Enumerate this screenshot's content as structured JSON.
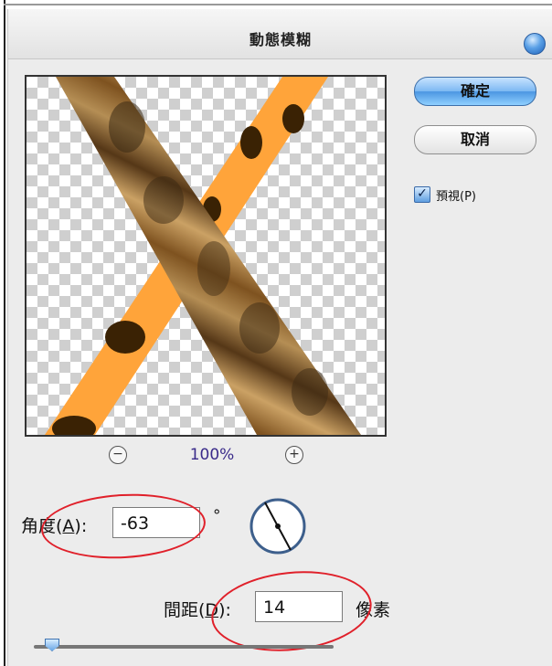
{
  "dialog": {
    "title": "動態模糊"
  },
  "buttons": {
    "ok_label": "確定",
    "cancel_label": "取消"
  },
  "preview_option": {
    "label": "預視(P)",
    "checked": true
  },
  "zoom": {
    "level": "100%",
    "minus": "−",
    "plus": "+"
  },
  "angle": {
    "label_prefix": "角度(",
    "label_key": "A",
    "label_suffix": "):",
    "value": "-63",
    "unit": "°"
  },
  "distance": {
    "label_prefix": "間距(",
    "label_key": "D",
    "label_suffix": "):",
    "value": "14",
    "unit": "像素"
  },
  "colors": {
    "orange_stripe": "#ffa43a",
    "leopard_spots": "#3a2204",
    "fur_light": "#d29a4a",
    "fur_dark": "#3b2a14",
    "annotation_red": "#e0202a",
    "accent_blue": "#5aa0e6"
  }
}
